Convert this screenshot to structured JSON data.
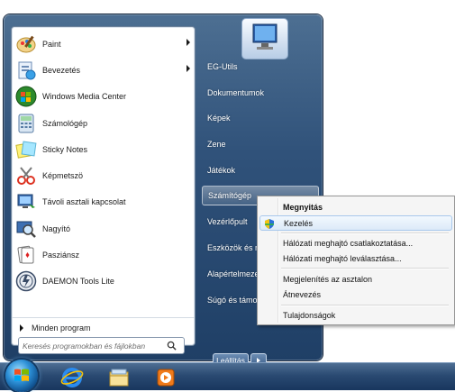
{
  "start_menu": {
    "programs": [
      {
        "label": "Paint",
        "icon": "paint-icon",
        "submenu": true
      },
      {
        "label": "Bevezetés",
        "icon": "getting-started-icon",
        "submenu": true
      },
      {
        "label": "Windows Media Center",
        "icon": "media-center-icon",
        "submenu": false
      },
      {
        "label": "Számológép",
        "icon": "calculator-icon",
        "submenu": false
      },
      {
        "label": "Sticky Notes",
        "icon": "sticky-notes-icon",
        "submenu": false
      },
      {
        "label": "Képmetszö",
        "icon": "snipping-tool-icon",
        "submenu": false
      },
      {
        "label": "Távoli asztali kapcsolat",
        "icon": "remote-desktop-icon",
        "submenu": false
      },
      {
        "label": "Nagyító",
        "icon": "magnifier-icon",
        "submenu": false
      },
      {
        "label": "Pasziánsz",
        "icon": "solitaire-icon",
        "submenu": false
      },
      {
        "label": "DAEMON Tools Lite",
        "icon": "daemon-tools-icon",
        "submenu": false
      }
    ],
    "all_programs_label": "Minden program",
    "search_placeholder": "Keresés programokban és fájlokban",
    "right_links": [
      "EG-Utils",
      "Dokumentumok",
      "Képek",
      "Zene",
      "Játékok",
      "Számítógép",
      "Vezérlőpult",
      "Eszközök és ny",
      "Alapértelmeze",
      "Súgó és támo"
    ],
    "highlighted_link": "Számítógép",
    "shutdown_label": "Leállítás"
  },
  "context_menu": {
    "items": [
      {
        "label": "Megnyitás",
        "bold": true
      },
      {
        "label": "Kezelés",
        "hover": true,
        "icon": "uac-shield-icon"
      },
      {
        "label": "Hálózati meghajtó csatlakoztatása..."
      },
      {
        "label": "Hálózati meghajtó leválasztása..."
      },
      {
        "label": "Megjelenítés az asztalon"
      },
      {
        "label": "Átnevezés"
      },
      {
        "label": "Tulajdonságok"
      }
    ]
  },
  "taskbar": {
    "buttons": [
      "start-orb-icon",
      "internet-explorer-icon",
      "file-explorer-icon",
      "media-player-icon"
    ]
  },
  "colors": {
    "menu_blue": "#30527a",
    "hover_blue": "#dceaf8",
    "taskbar_blue": "#2a4a72"
  }
}
